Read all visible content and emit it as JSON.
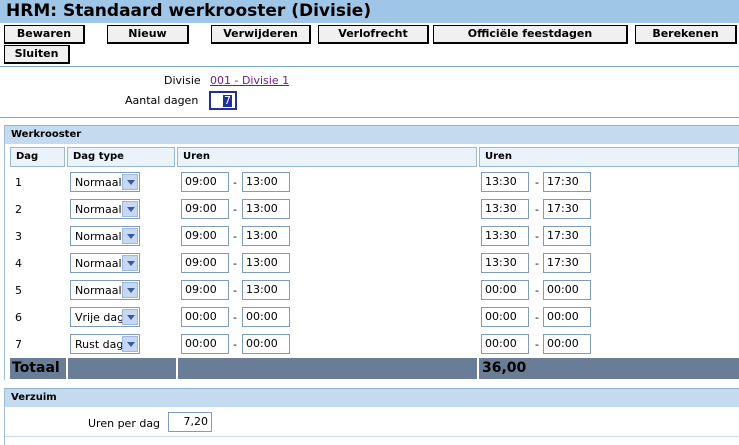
{
  "window": {
    "title": "HRM: Standaard werkrooster (Divisie)"
  },
  "toolbar": {
    "bewaren": "Bewaren",
    "nieuw": "Nieuw",
    "verwijderen": "Verwijderen",
    "verlofrecht": "Verlofrecht",
    "feestdagen": "Officiële feestdagen",
    "berekenen": "Berekenen",
    "sluiten": "Sluiten"
  },
  "form": {
    "divisie_label": "Divisie",
    "divisie_value": "001 - Divisie 1",
    "aantal_dagen_label": "Aantal dagen",
    "aantal_dagen_value": "7"
  },
  "werkrooster": {
    "title": "Werkrooster",
    "headers": {
      "dag": "Dag",
      "dag_type": "Dag type",
      "uren1": "Uren",
      "uren2": "Uren"
    },
    "rows": [
      {
        "dag": "1",
        "type": "Normaal",
        "s1": "09:00",
        "e1": "13:00",
        "s2": "13:30",
        "e2": "17:30"
      },
      {
        "dag": "2",
        "type": "Normaal",
        "s1": "09:00",
        "e1": "13:00",
        "s2": "13:30",
        "e2": "17:30"
      },
      {
        "dag": "3",
        "type": "Normaal",
        "s1": "09:00",
        "e1": "13:00",
        "s2": "13:30",
        "e2": "17:30"
      },
      {
        "dag": "4",
        "type": "Normaal",
        "s1": "09:00",
        "e1": "13:00",
        "s2": "13:30",
        "e2": "17:30"
      },
      {
        "dag": "5",
        "type": "Normaal",
        "s1": "09:00",
        "e1": "13:00",
        "s2": "00:00",
        "e2": "00:00"
      },
      {
        "dag": "6",
        "type": "Vrije dag",
        "s1": "00:00",
        "e1": "00:00",
        "s2": "00:00",
        "e2": "00:00"
      },
      {
        "dag": "7",
        "type": "Rust dag",
        "s1": "00:00",
        "e1": "00:00",
        "s2": "00:00",
        "e2": "00:00"
      }
    ],
    "dash": "-",
    "totaal_label": "Totaal",
    "totaal_value": "36,00"
  },
  "verzuim": {
    "title": "Verzuim",
    "uren_per_dag_label": "Uren per dag",
    "uren_per_dag_value": "7,20"
  }
}
